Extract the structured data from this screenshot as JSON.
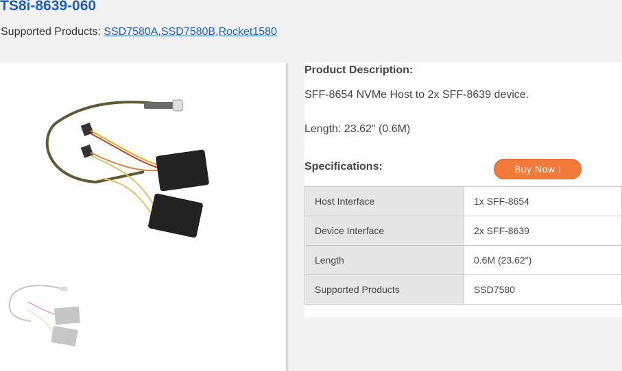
{
  "product": {
    "title": "TS8i-8639-060",
    "supported_prefix": "Supported Products: ",
    "supported_links": [
      "SSD7580A",
      "SSD7580B",
      "Rocket1580"
    ]
  },
  "info": {
    "description_heading": "Product Description:",
    "description": "SFF-8654 NVMe Host to 2x SFF-8639 device.",
    "length": "Length: 23.62\" (0.6M)",
    "spec_heading": "Specifications:",
    "buy_label": "Buy Now !"
  },
  "specs": [
    {
      "label": "Host Interface",
      "value": "1x SFF-8654"
    },
    {
      "label": "Device Interface",
      "value": "2x SFF-8639"
    },
    {
      "label": "Length",
      "value": "0.6M (23.62\")"
    },
    {
      "label": "Supported Products",
      "value": "SSD7580"
    }
  ],
  "colors": {
    "link": "#1f5fbf",
    "buy_button": "#f27a3a",
    "spec_label_bg": "#e6e6e6"
  }
}
